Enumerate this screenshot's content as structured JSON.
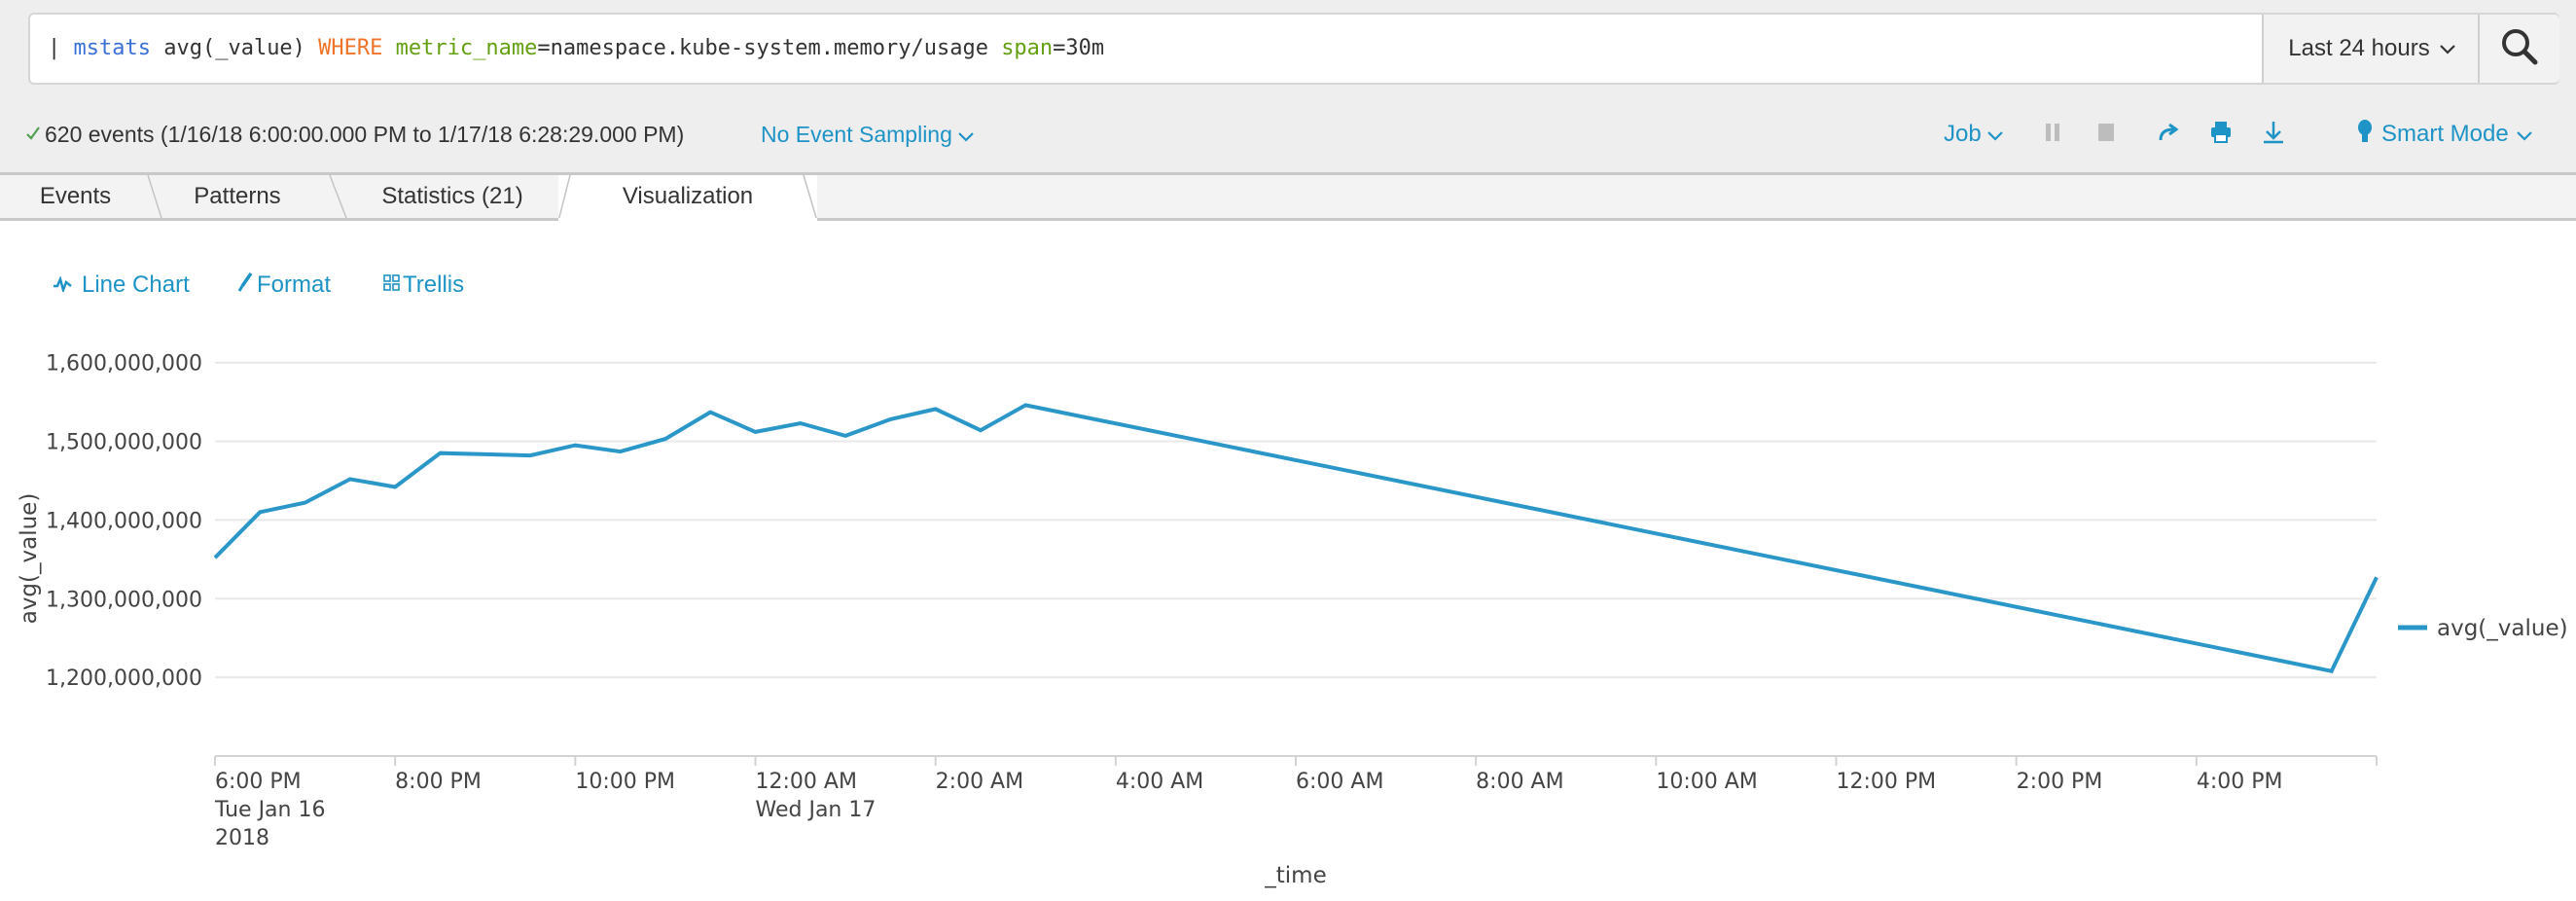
{
  "search": {
    "query_tokens": [
      {
        "text": "| ",
        "kind": "pipe"
      },
      {
        "text": "mstats",
        "kind": "cmd"
      },
      {
        "text": " avg(_value) ",
        "kind": "plain"
      },
      {
        "text": "WHERE",
        "kind": "kw"
      },
      {
        "text": " ",
        "kind": "plain"
      },
      {
        "text": "metric_name",
        "kind": "field"
      },
      {
        "text": "=namespace.kube-system.memory/usage ",
        "kind": "plain"
      },
      {
        "text": "span",
        "kind": "field"
      },
      {
        "text": "=30m",
        "kind": "plain"
      }
    ],
    "time_range": "Last 24 hours",
    "search_button_icon": "search-icon"
  },
  "status": {
    "icon": "check-icon",
    "text": "620 events (1/16/18 6:00:00.000 PM to 1/17/18 6:28:29.000 PM)",
    "sampling": "No Event Sampling"
  },
  "job_toolbar": {
    "job_label": "Job",
    "icons": [
      "pause-icon",
      "stop-icon",
      "share-icon",
      "print-icon",
      "export-icon"
    ],
    "mode_label": "Smart Mode"
  },
  "tabs": [
    {
      "label": "Events",
      "active": false
    },
    {
      "label": "Patterns",
      "active": false
    },
    {
      "label": "Statistics (21)",
      "active": false
    },
    {
      "label": "Visualization",
      "active": true
    }
  ],
  "viz_links": [
    {
      "label": "Line Chart",
      "icon": "line-chart-icon"
    },
    {
      "label": "Format",
      "icon": "paintbrush-icon"
    },
    {
      "label": "Trellis",
      "icon": "trellis-grid-icon"
    }
  ],
  "colors": {
    "accent": "#1e93c6",
    "series": "#2b97c9",
    "gridline": "#e8e8e8",
    "check": "#53a051"
  },
  "chart_data": {
    "type": "line",
    "title": "",
    "xlabel": "_time",
    "ylabel": "avg(_value)",
    "ylim": [
      1100000000,
      1600000000
    ],
    "yticks": [
      1200000000,
      1300000000,
      1400000000,
      1500000000,
      1600000000
    ],
    "ytick_labels": [
      "1,200,000,000",
      "1,300,000,000",
      "1,400,000,000",
      "1,500,000,000",
      "1,600,000,000"
    ],
    "x_unit": "hours since 6:00 PM Tue Jan 16 2018",
    "xlim": [
      0,
      24
    ],
    "xticks": [
      {
        "hour": 0,
        "lines": [
          "6:00 PM",
          "Tue Jan 16",
          "2018"
        ]
      },
      {
        "hour": 2,
        "lines": [
          "8:00 PM"
        ]
      },
      {
        "hour": 4,
        "lines": [
          "10:00 PM"
        ]
      },
      {
        "hour": 6,
        "lines": [
          "12:00 AM",
          "Wed Jan 17"
        ]
      },
      {
        "hour": 8,
        "lines": [
          "2:00 AM"
        ]
      },
      {
        "hour": 10,
        "lines": [
          "4:00 AM"
        ]
      },
      {
        "hour": 12,
        "lines": [
          "6:00 AM"
        ]
      },
      {
        "hour": 14,
        "lines": [
          "8:00 AM"
        ]
      },
      {
        "hour": 16,
        "lines": [
          "10:00 AM"
        ]
      },
      {
        "hour": 18,
        "lines": [
          "12:00 PM"
        ]
      },
      {
        "hour": 20,
        "lines": [
          "2:00 PM"
        ]
      },
      {
        "hour": 22,
        "lines": [
          "4:00 PM"
        ]
      }
    ],
    "grid": true,
    "legend": "right",
    "series": [
      {
        "name": "avg(_value)",
        "points": [
          {
            "t": "6:00 PM",
            "x": 0.0,
            "y": 1352000000
          },
          {
            "t": "6:30 PM",
            "x": 0.5,
            "y": 1410000000
          },
          {
            "t": "7:00 PM",
            "x": 1.0,
            "y": 1422000000
          },
          {
            "t": "7:30 PM",
            "x": 1.5,
            "y": 1452000000
          },
          {
            "t": "8:00 PM",
            "x": 2.0,
            "y": 1442000000
          },
          {
            "t": "8:30 PM",
            "x": 2.5,
            "y": 1485000000
          },
          {
            "t": "9:30 PM",
            "x": 3.5,
            "y": 1482000000
          },
          {
            "t": "10:00 PM",
            "x": 4.0,
            "y": 1495000000
          },
          {
            "t": "10:30 PM",
            "x": 4.5,
            "y": 1487000000
          },
          {
            "t": "11:00 PM",
            "x": 5.0,
            "y": 1503000000
          },
          {
            "t": "11:30 PM",
            "x": 5.5,
            "y": 1537000000
          },
          {
            "t": "12:00 AM",
            "x": 6.0,
            "y": 1512000000
          },
          {
            "t": "12:30 AM",
            "x": 6.5,
            "y": 1523000000
          },
          {
            "t": "1:00 AM",
            "x": 7.0,
            "y": 1507000000
          },
          {
            "t": "1:30 AM",
            "x": 7.5,
            "y": 1528000000
          },
          {
            "t": "2:00 AM",
            "x": 8.0,
            "y": 1541000000
          },
          {
            "t": "2:30 AM",
            "x": 8.5,
            "y": 1514000000
          },
          {
            "t": "3:00 AM",
            "x": 9.0,
            "y": 1546000000
          },
          {
            "t": "5:30 PM",
            "x": 23.5,
            "y": 1208000000
          },
          {
            "t": "6:00 PM",
            "x": 24.0,
            "y": 1327000000
          }
        ]
      }
    ]
  }
}
